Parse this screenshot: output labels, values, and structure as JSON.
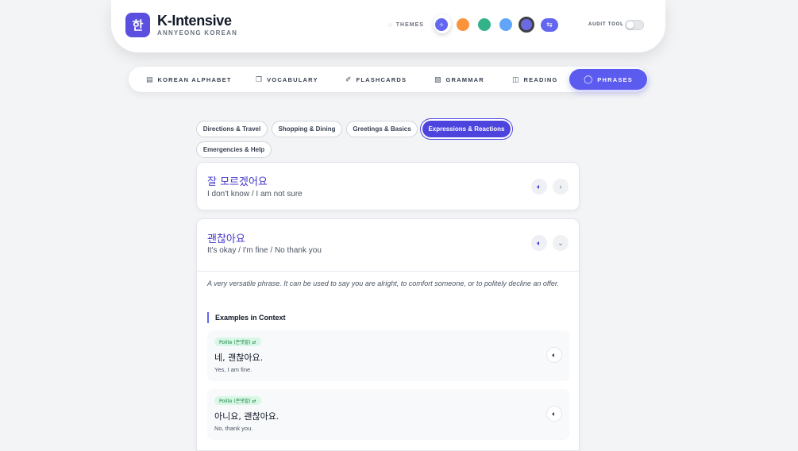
{
  "header": {
    "logo_char": "한",
    "title": "K-Intensive",
    "subtitle": "ANNYEONG KOREAN",
    "themes_label": "THEMES",
    "audit_label": "AUDIT TOOL",
    "theme_colors": [
      "#6366f1",
      "#fb923c",
      "#34b38a",
      "#60a5fa",
      "#6b6ae0"
    ]
  },
  "nav": {
    "items": [
      {
        "label": "KOREAN ALPHABET",
        "icon": "book-icon"
      },
      {
        "label": "VOCABULARY",
        "icon": "cards-icon"
      },
      {
        "label": "FLASHCARDS",
        "icon": "brain-icon"
      },
      {
        "label": "GRAMMAR",
        "icon": "scroll-icon"
      },
      {
        "label": "READING",
        "icon": "open-book-icon"
      },
      {
        "label": "PHRASES",
        "icon": "chat-bubble-icon",
        "active": true
      }
    ]
  },
  "categories": [
    "Directions & Travel",
    "Shopping & Dining",
    "Greetings & Basics",
    "Expressions & Reactions",
    "Emergencies & Help"
  ],
  "active_category": "Expressions & Reactions",
  "phrases": [
    {
      "korean": "잘 모르겠어요",
      "english": "I don't know / I am not sure",
      "expanded": false
    },
    {
      "korean": "괜찮아요",
      "english": "It's okay / I'm fine / No thank you",
      "expanded": true,
      "description": "A very versatile phrase. It can be used to say you are alright, to comfort someone, or to politely decline an offer.",
      "context_title": "Examples in Context",
      "examples": [
        {
          "badge": "Polite (존댓말) ⇄",
          "korean": "네, 괜찮아요.",
          "english": "Yes, I am fine."
        },
        {
          "badge": "Polite (존댓말) ⇄",
          "korean": "아니요, 괜찮아요.",
          "english": "No, thank you."
        }
      ]
    }
  ]
}
